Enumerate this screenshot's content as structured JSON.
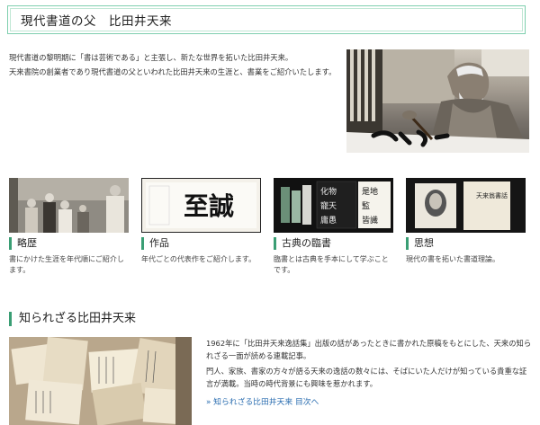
{
  "page": {
    "title": "現代書道の父　比田井天来",
    "intro": [
      "現代書道の黎明期に「書は芸術である」と主張し、新たな世界を拓いた比田井天来。",
      "天来書院の創業者であり現代書道の父といわれた比田井天来の生涯と、書業をご紹介いたします。"
    ]
  },
  "cards": [
    {
      "title": "略歴",
      "desc": "書にかけた生涯を年代順にご紹介します。"
    },
    {
      "title": "作品",
      "desc": "年代ごとの代表作をご紹介します。"
    },
    {
      "title": "古典の臨書",
      "desc": "臨書とは古典を手本にして学ぶことです。"
    },
    {
      "title": "思想",
      "desc": "現代の書を拓いた書道理論。"
    }
  ],
  "calligraphy": {
    "main": "至誠",
    "classic_columns": [
      "化物",
      "寵天",
      "庸愚",
      "是地",
      "監",
      "皆識"
    ],
    "book_title": "天来翁書話"
  },
  "unknown_section": {
    "heading": "知られざる比田井天来",
    "paragraphs": [
      "1962年に「比田井天来逸話集」出版の話があったときに書かれた原稿をもとにした、天来の知られざる一面が読める連載記事。",
      "門人、家族、書家の方々が語る天来の逸話の数々には、そばにいた人だけが知っている貴重な証言が満載。当時の時代背景にも興味を惹かれます。"
    ],
    "link": "» 知られざる比田井天来 目次へ"
  },
  "colors": {
    "accent": "#3a9e74",
    "title_border": "#7ecfae",
    "link": "#2a6db0"
  }
}
